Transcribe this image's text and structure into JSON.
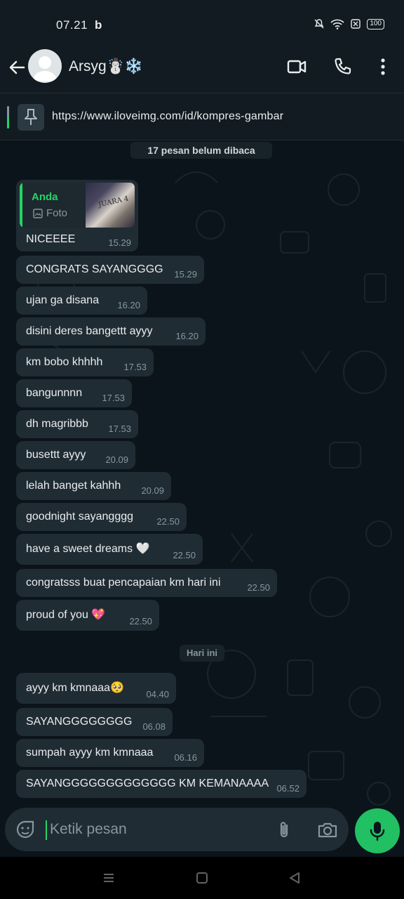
{
  "status_bar": {
    "time": "07.21",
    "app_indicator": "b",
    "battery": "100"
  },
  "header": {
    "contact_name": "Arsyg☃️❄️"
  },
  "pinned": {
    "text": "https://www.iloveimg.com/id/kompres-gambar"
  },
  "unread_banner": "17 pesan belum dibaca",
  "reply_message": {
    "quote_author": "Anda",
    "quote_type": "Foto",
    "thumb_caption": "JUARA 4",
    "text": "NICEEEE",
    "time": "15.29"
  },
  "messages": [
    {
      "text": "CONGRATS SAYANGGGG",
      "time": "15.29"
    },
    {
      "text": "ujan ga disana",
      "time": "16.20"
    },
    {
      "text": "disini deres bangettt ayyy",
      "time": "16.20"
    },
    {
      "text": "km bobo khhhh",
      "time": "17.53"
    },
    {
      "text": "bangunnnn",
      "time": "17.53"
    },
    {
      "text": "dh magribbb",
      "time": "17.53"
    },
    {
      "text": "busettt ayyy",
      "time": "20.09"
    },
    {
      "text": "lelah banget kahhh",
      "time": "20.09"
    },
    {
      "text": "goodnight sayangggg",
      "time": "22.50"
    },
    {
      "text": "have a sweet dreams 🤍",
      "time": "22.50"
    },
    {
      "text": "congratsss buat pencapaian km hari ini",
      "time": "22.50"
    },
    {
      "text": "proud of you 💖",
      "time": "22.50"
    }
  ],
  "date_chip": "Hari ini",
  "messages_today": [
    {
      "text": "ayyy km kmnaaa🥺",
      "time": "04.40"
    },
    {
      "text": "SAYANGGGGGGGG",
      "time": "06.08"
    },
    {
      "text": "sumpah ayyy km kmnaaa",
      "time": "06.16"
    },
    {
      "text": "SAYANGGGGGGGGGGGGG KM KEMANAAAA",
      "time": "06.52"
    }
  ],
  "composer": {
    "placeholder": "Ketik pesan"
  },
  "colors": {
    "accent": "#25d366",
    "bubble": "#202c33",
    "background": "#0b141a",
    "header": "#111b21"
  }
}
